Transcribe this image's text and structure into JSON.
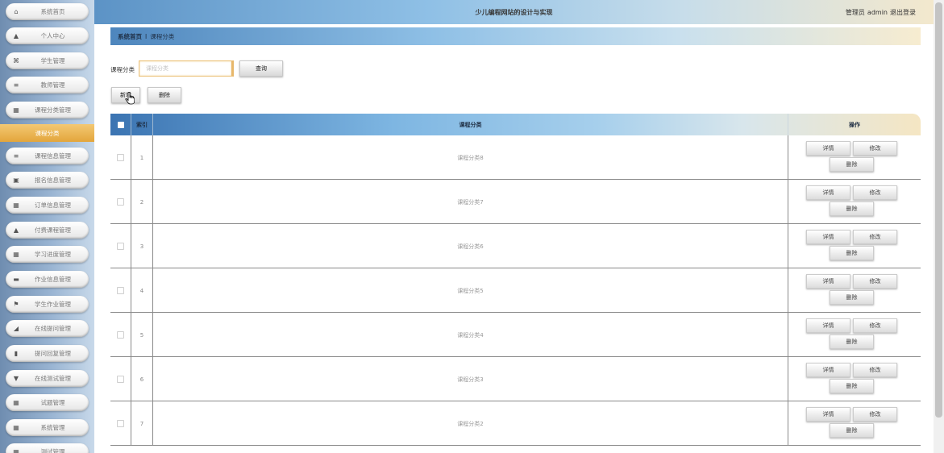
{
  "header": {
    "title": "少儿编程网站的设计与实现",
    "user_role": "管理员",
    "username": "admin",
    "logout": "退出登录"
  },
  "sidebar": {
    "items": [
      {
        "label": "系统首页",
        "icon": "home-icon",
        "glyph": "⌂"
      },
      {
        "label": "个人中心",
        "icon": "user-icon",
        "glyph": "▲"
      },
      {
        "label": "学生管理",
        "icon": "users-icon",
        "glyph": "⌘"
      },
      {
        "label": "教师管理",
        "icon": "list-icon",
        "glyph": "≡"
      },
      {
        "label": "课程分类管理",
        "icon": "grid-icon",
        "glyph": "▦"
      },
      {
        "label": "课程信息管理",
        "icon": "list-icon",
        "glyph": "≡"
      },
      {
        "label": "报名信息管理",
        "icon": "clipboard-icon",
        "glyph": "▣"
      },
      {
        "label": "订单信息管理",
        "icon": "grid-icon",
        "glyph": "▦"
      },
      {
        "label": "付费课程管理",
        "icon": "user-icon",
        "glyph": "▲"
      },
      {
        "label": "学习进度管理",
        "icon": "grid-icon",
        "glyph": "▦"
      },
      {
        "label": "作业信息管理",
        "icon": "monitor-icon",
        "glyph": "▬"
      },
      {
        "label": "学生作业管理",
        "icon": "flag-icon",
        "glyph": "⚑"
      },
      {
        "label": "在线提问管理",
        "icon": "area-chart-icon",
        "glyph": "◢"
      },
      {
        "label": "提问回复管理",
        "icon": "bar-chart-icon",
        "glyph": "▮"
      },
      {
        "label": "在线测试管理",
        "icon": "filter-icon",
        "glyph": "▼"
      },
      {
        "label": "试题管理",
        "icon": "grid-icon",
        "glyph": "▦"
      },
      {
        "label": "系统管理",
        "icon": "grid-icon",
        "glyph": "▦"
      },
      {
        "label": "测试管理",
        "icon": "grid-icon",
        "glyph": "▦"
      }
    ],
    "active_sub": "课程分类"
  },
  "breadcrumb": {
    "home": "系统首页",
    "sep": "Ι",
    "current": "课程分类"
  },
  "search": {
    "label": "课程分类",
    "placeholder": "课程分类",
    "query_button": "查询"
  },
  "actions": {
    "add": "新增",
    "delete": "删除"
  },
  "table": {
    "headers": {
      "index": "索引",
      "category": "课程分类",
      "operation": "操作"
    },
    "rows": [
      {
        "index": "1",
        "category": "课程分类8"
      },
      {
        "index": "2",
        "category": "课程分类7"
      },
      {
        "index": "3",
        "category": "课程分类6"
      },
      {
        "index": "4",
        "category": "课程分类5"
      },
      {
        "index": "5",
        "category": "课程分类4"
      },
      {
        "index": "6",
        "category": "课程分类3"
      },
      {
        "index": "7",
        "category": "课程分类2"
      }
    ],
    "row_buttons": {
      "detail": "详情",
      "edit": "修改",
      "delete": "删除"
    }
  },
  "colors": {
    "accent_orange": "#e3a63c",
    "header_blue": "#3b74b2"
  }
}
